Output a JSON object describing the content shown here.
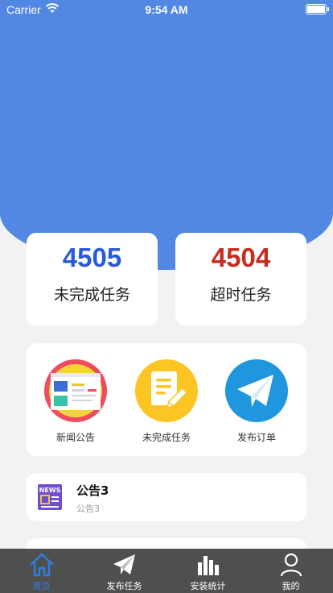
{
  "status_bar": {
    "carrier": "Carrier",
    "time": "9:54 AM"
  },
  "stats": [
    {
      "value": "4505",
      "label": "未完成任务",
      "color": "#2a5bd7"
    },
    {
      "value": "4504",
      "label": "超时任务",
      "color": "#c62d1f"
    }
  ],
  "menu": [
    {
      "label": "新闻公告",
      "icon": "news-board-icon"
    },
    {
      "label": "未完成任务",
      "icon": "note-pencil-icon"
    },
    {
      "label": "发布订单",
      "icon": "paper-plane-icon"
    }
  ],
  "notices": [
    {
      "title": "公告3",
      "subtitle": "公告3",
      "icon": "news-icon"
    }
  ],
  "tabbar": {
    "active": 0,
    "tabs": [
      {
        "label": "首页",
        "icon": "home-icon"
      },
      {
        "label": "发布任务",
        "icon": "send-icon"
      },
      {
        "label": "安装统计",
        "icon": "bar-chart-icon"
      },
      {
        "label": "我的",
        "icon": "user-icon"
      }
    ]
  },
  "colors": {
    "primary": "#5288e3",
    "tab_active": "#2f7de1",
    "tabbar_bg": "#4f4f4f"
  }
}
